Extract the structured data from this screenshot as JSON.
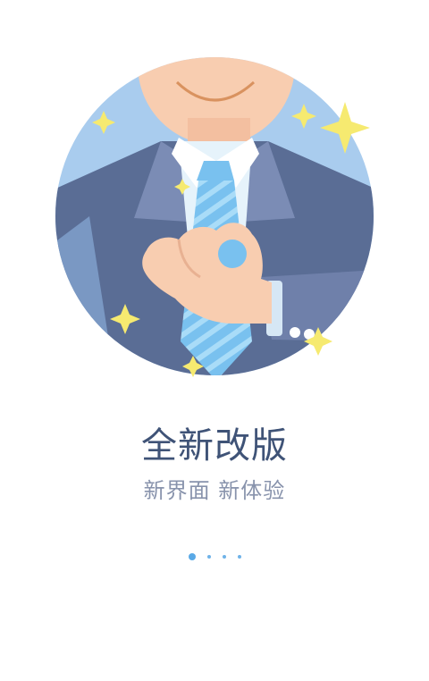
{
  "onboarding": {
    "title": "全新改版",
    "subtitle": "新界面 新体验",
    "illustration_icon": "businessman-ok-gesture-icon",
    "pager": {
      "total": 4,
      "current": 1
    },
    "colors": {
      "title": "#3f5377",
      "subtitle": "#8893ac",
      "pager_dot": "#6fb3e8",
      "pager_dot_active": "#5aa9e6",
      "circle_background": "#a9ccee",
      "suit": "#5a6d95",
      "tie": "#79c1ef",
      "skin": "#f8cdb0",
      "sparkle": "#f6ea70"
    }
  }
}
